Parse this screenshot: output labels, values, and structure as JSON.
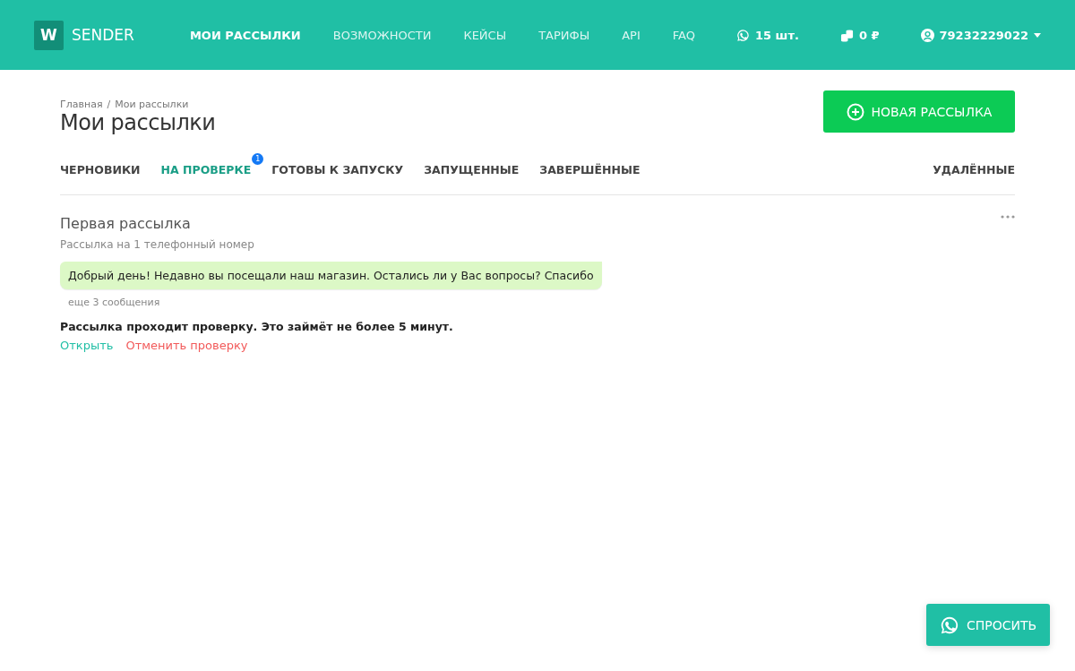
{
  "header": {
    "logo_letter": "W",
    "logo_text": "SENDER",
    "nav": [
      {
        "label": "МОИ РАССЫЛКИ",
        "selected": true
      },
      {
        "label": "ВОЗМОЖНОСТИ",
        "selected": false
      },
      {
        "label": "КЕЙСЫ",
        "selected": false
      },
      {
        "label": "ТАРИФЫ",
        "selected": false
      },
      {
        "label": "API",
        "selected": false
      },
      {
        "label": "FAQ",
        "selected": false
      }
    ],
    "messages_count": "15 шт.",
    "balance": "0 ₽",
    "account": "79232229022"
  },
  "breadcrumbs": [
    "Главная",
    "Мои рассылки"
  ],
  "breadcrumb_separator": "/",
  "page_title": "Мои рассылки",
  "new_button": "НОВАЯ РАССЫЛКА",
  "tabs": [
    {
      "label": "ЧЕРНОВИКИ",
      "selected": false
    },
    {
      "label": "НА ПРОВЕРКЕ",
      "selected": true,
      "badge": "1"
    },
    {
      "label": "ГОТОВЫ К ЗАПУСКУ",
      "selected": false
    },
    {
      "label": "ЗАПУЩЕННЫЕ",
      "selected": false
    },
    {
      "label": "ЗАВЕРШЁННЫЕ",
      "selected": false
    }
  ],
  "deleted_tab": {
    "label": "УДАЛЁННЫЕ",
    "selected": false
  },
  "campaign": {
    "title": "Первая рассылка",
    "subtitle": "Рассылка на 1 телефонный номер",
    "message": "Добрый день! Недавно вы посещали наш магазин. Остались ли у Вас вопросы? Спасибо",
    "more": "еще 3 сообщения",
    "status": "Рассылка проходит проверку. Это займёт не более 5 минут.",
    "open_link": "Открыть",
    "cancel_link": "Отменить проверку"
  },
  "ask_button": "СПРОСИТЬ"
}
